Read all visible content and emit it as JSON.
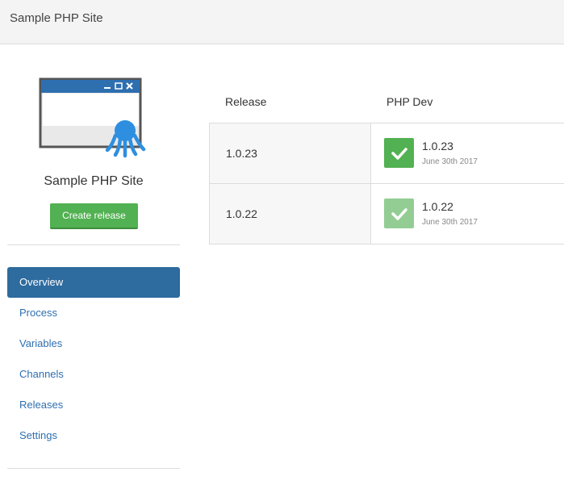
{
  "header": {
    "title": "Sample PHP Site"
  },
  "project": {
    "name": "Sample PHP Site",
    "create_release_label": "Create release"
  },
  "nav": {
    "items": [
      {
        "label": "Overview",
        "active": true
      },
      {
        "label": "Process"
      },
      {
        "label": "Variables"
      },
      {
        "label": "Channels"
      },
      {
        "label": "Releases"
      },
      {
        "label": "Settings"
      }
    ]
  },
  "table": {
    "columns": [
      "Release",
      "PHP Dev"
    ],
    "rows": [
      {
        "release": "1.0.23",
        "deploy_version": "1.0.23",
        "deploy_date": "June 30th 2017",
        "status": "success"
      },
      {
        "release": "1.0.22",
        "deploy_version": "1.0.22",
        "deploy_date": "June 30th 2017",
        "status": "success-previous"
      }
    ]
  },
  "colors": {
    "accent": "#2e6b9e",
    "success": "#52b152",
    "success_faded": "#93cd93",
    "link": "#2e6fb0"
  },
  "icons": {
    "logo": "octopus-window-logo",
    "status": "checkmark-icon"
  }
}
